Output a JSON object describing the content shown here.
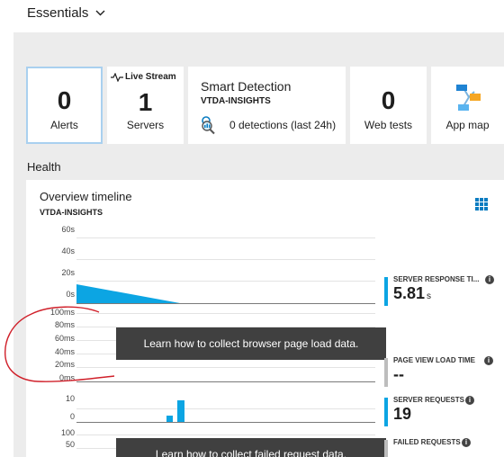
{
  "essentials": {
    "label": "Essentials"
  },
  "tiles": {
    "alerts": {
      "value": "0",
      "label": "Alerts"
    },
    "servers": {
      "live_label": "Live Stream",
      "value": "1",
      "label": "Servers"
    },
    "smart": {
      "title": "Smart Detection",
      "subtitle": "VTDA-INSIGHTS",
      "detections": "0 detections (last 24h)"
    },
    "webtests": {
      "value": "0",
      "label": "Web tests"
    },
    "appmap": {
      "label": "App map"
    }
  },
  "health": {
    "label": "Health"
  },
  "timeline": {
    "title": "Overview timeline",
    "subtitle": "VTDA-INSIGHTS",
    "charts": {
      "response": {
        "ticks": [
          "60s",
          "40s",
          "20s",
          "0s"
        ]
      },
      "pageview": {
        "ticks": [
          "100ms",
          "80ms",
          "60ms",
          "40ms",
          "20ms",
          "0ms"
        ],
        "overlay": "Learn how to collect browser page load data."
      },
      "requests": {
        "ticks": [
          "10",
          "0"
        ],
        "bars": [
          4,
          14
        ]
      },
      "failed": {
        "ticks": [
          "100",
          "50"
        ],
        "overlay": "Learn how to collect failed request data."
      }
    },
    "metrics": {
      "server_response": {
        "label": "SERVER RESPONSE TI...",
        "value": "5.81",
        "unit": "s"
      },
      "page_view": {
        "label": "PAGE VIEW LOAD TIME",
        "value": "--"
      },
      "server_requests": {
        "label": "SERVER REQUESTS",
        "value": "19"
      },
      "failed_requests": {
        "label": "FAILED REQUESTS"
      }
    }
  },
  "colors": {
    "accent": "#0ca5e3",
    "overlay": "#404040",
    "annotation": "#d0202a"
  }
}
